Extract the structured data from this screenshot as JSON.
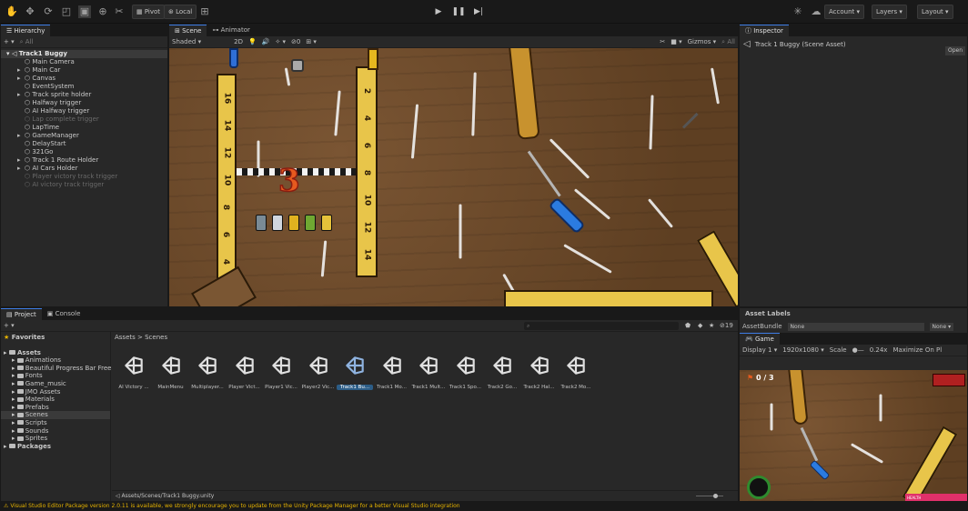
{
  "toolbar": {
    "icons": [
      "hand-icon",
      "move-icon",
      "rotate-icon",
      "scale-icon",
      "rect-icon",
      "transform-icon",
      "tools-icon"
    ],
    "pivot_label": "Pivot",
    "local_label": "Local",
    "account_label": "Account",
    "layers_label": "Layers",
    "layout_label": "Layout"
  },
  "hierarchy": {
    "tab": "Hierarchy",
    "search_placeholder": "All",
    "scene_name": "Track1 Buggy",
    "items": [
      {
        "label": "Main Camera",
        "dim": false,
        "expandable": false
      },
      {
        "label": "Main Car",
        "dim": false,
        "expandable": true
      },
      {
        "label": "Canvas",
        "dim": false,
        "expandable": true
      },
      {
        "label": "EventSystem",
        "dim": false,
        "expandable": false
      },
      {
        "label": "Track sprite holder",
        "dim": false,
        "expandable": true
      },
      {
        "label": "Halfway trigger",
        "dim": false,
        "expandable": false
      },
      {
        "label": "AI Halfway trigger",
        "dim": false,
        "expandable": false
      },
      {
        "label": "Lap complete trigger",
        "dim": true,
        "expandable": false
      },
      {
        "label": "LapTime",
        "dim": false,
        "expandable": false
      },
      {
        "label": "GameManager",
        "dim": false,
        "expandable": true
      },
      {
        "label": "DelayStart",
        "dim": false,
        "expandable": false
      },
      {
        "label": "321Go",
        "dim": false,
        "expandable": false
      },
      {
        "label": "Track 1 Route Holder",
        "dim": false,
        "expandable": true
      },
      {
        "label": "AI Cars Holder",
        "dim": false,
        "expandable": true
      },
      {
        "label": "Player victory track trigger",
        "dim": true,
        "expandable": false
      },
      {
        "label": "AI victory track trigger",
        "dim": true,
        "expandable": false
      }
    ]
  },
  "scene": {
    "tabs": [
      "Scene",
      "Animator"
    ],
    "shading": "Shaded",
    "mode_2d": "2D",
    "gizmos": "Gizmos",
    "search_placeholder": "All",
    "countdown": "3"
  },
  "inspector": {
    "tab": "Inspector",
    "asset_title": "Track 1 Buggy (Scene Asset)",
    "open_button": "Open"
  },
  "project": {
    "tabs": [
      "Project",
      "Console"
    ],
    "breadcrumb": [
      "Assets",
      "Scenes"
    ],
    "hidden_count": "19",
    "favorites": "Favorites",
    "tree": [
      {
        "label": "Assets",
        "indent": 0,
        "selected": false
      },
      {
        "label": "Animations",
        "indent": 1,
        "selected": false
      },
      {
        "label": "Beautiful Progress Bar Free",
        "indent": 1,
        "selected": false
      },
      {
        "label": "Fonts",
        "indent": 1,
        "selected": false
      },
      {
        "label": "Game_music",
        "indent": 1,
        "selected": false
      },
      {
        "label": "JMO Assets",
        "indent": 1,
        "selected": false
      },
      {
        "label": "Materials",
        "indent": 1,
        "selected": false
      },
      {
        "label": "Prefabs",
        "indent": 1,
        "selected": false
      },
      {
        "label": "Scenes",
        "indent": 1,
        "selected": true
      },
      {
        "label": "Scripts",
        "indent": 1,
        "selected": false
      },
      {
        "label": "Sounds",
        "indent": 1,
        "selected": false
      },
      {
        "label": "Sprites",
        "indent": 1,
        "selected": false
      },
      {
        "label": "Packages",
        "indent": 0,
        "selected": false
      }
    ],
    "assets": [
      {
        "label": "AI Victory ...",
        "selected": false
      },
      {
        "label": "MainMenu",
        "selected": false
      },
      {
        "label": "Multiplayer...",
        "selected": false
      },
      {
        "label": "Player Vict...",
        "selected": false
      },
      {
        "label": "Player1 Vic...",
        "selected": false
      },
      {
        "label": "Player2 Vic...",
        "selected": false
      },
      {
        "label": "Track1 Bu...",
        "selected": true
      },
      {
        "label": "Track1 Mo...",
        "selected": false
      },
      {
        "label": "Track1 Mult...",
        "selected": false
      },
      {
        "label": "Track1 Spo...",
        "selected": false
      },
      {
        "label": "Track2 Go...",
        "selected": false
      },
      {
        "label": "Track2 Hal...",
        "selected": false
      },
      {
        "label": "Track2 Mo...",
        "selected": false
      }
    ],
    "path": "Assets/Scenes/Track1 Buggy.unity"
  },
  "asset_labels": {
    "title": "Asset Labels",
    "bundle_label": "AssetBundle",
    "bundle_value": "None",
    "variant_value": "None"
  },
  "game": {
    "tab": "Game",
    "display": "Display 1",
    "resolution": "1920x1080",
    "scale_label": "Scale",
    "scale_value": "0.24x",
    "maximize": "Maximize On Pl",
    "lap_text": "0 / 3",
    "health_label": "HEALTH"
  },
  "status": {
    "message": "Visual Studio Editor Package version 2.0.11 is available, we strongly encourage you to update from the Unity Package Manager for a better Visual Studio integration"
  },
  "colors": {
    "accent": "#3e7de6",
    "wood": "#6b4a2c",
    "ruler": "#e8c54a",
    "warning": "#e6b300"
  }
}
